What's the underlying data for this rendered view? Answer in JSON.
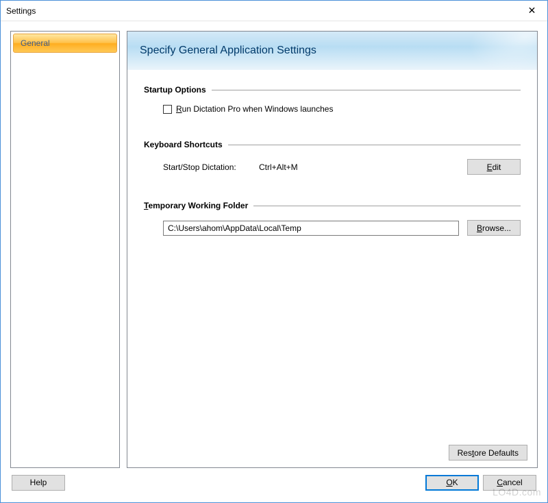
{
  "window": {
    "title": "Settings"
  },
  "sidebar": {
    "items": [
      {
        "label": "General"
      }
    ]
  },
  "panel": {
    "header": "Specify General Application Settings",
    "sections": {
      "startup": {
        "title": "Startup Options",
        "checkbox_label_pre": "R",
        "checkbox_label_rest": "un Dictation Pro when Windows launches",
        "checked": false
      },
      "shortcuts": {
        "title": "Keyboard Shortcuts",
        "row_label": "Start/Stop Dictation:",
        "row_value": "Ctrl+Alt+M",
        "edit_button_pre": "E",
        "edit_button_rest": "dit"
      },
      "tempfolder": {
        "title_pre": "T",
        "title_rest": "emporary Working Folder",
        "path": "C:\\Users\\ahom\\AppData\\Local\\Temp",
        "browse_button_pre": "B",
        "browse_button_rest": "rowse..."
      }
    },
    "restore_button_pre": "R",
    "restore_button_mid": "es",
    "restore_button_u": "t",
    "restore_button_rest": "ore Defaults"
  },
  "buttons": {
    "help": "Help",
    "ok_pre": "O",
    "ok_rest": "K",
    "cancel_pre": "C",
    "cancel_rest": "ancel"
  },
  "watermark": "LO4D.com"
}
